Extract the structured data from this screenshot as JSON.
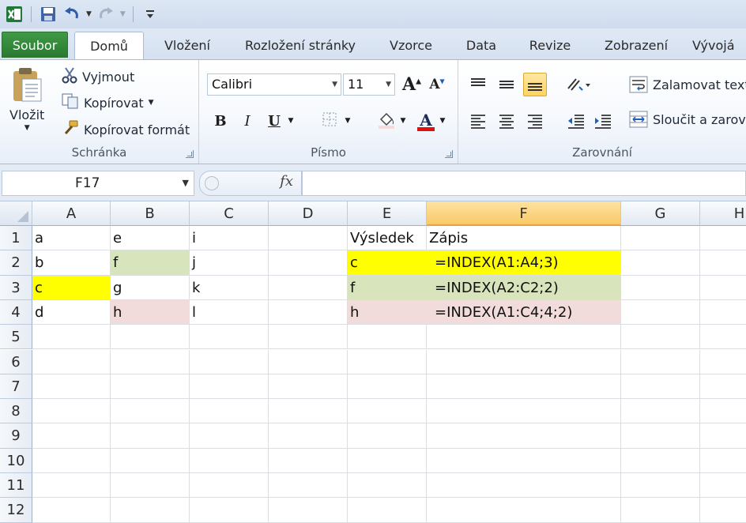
{
  "colors": {
    "yellow": "#ffff00",
    "green": "#d8e4bc",
    "pink": "#f2dcdb",
    "file_tab": "#2e7d32",
    "accent_blue": "#1f5fb4"
  },
  "qat": {
    "icons": [
      "excel-logo-icon",
      "save-icon",
      "undo-icon",
      "redo-icon",
      "customize-icon"
    ]
  },
  "tabs": [
    {
      "label": "Soubor",
      "active": false
    },
    {
      "label": "Domů",
      "active": true
    },
    {
      "label": "Vložení",
      "active": false
    },
    {
      "label": "Rozložení stránky",
      "active": false
    },
    {
      "label": "Vzorce",
      "active": false
    },
    {
      "label": "Data",
      "active": false
    },
    {
      "label": "Revize",
      "active": false
    },
    {
      "label": "Zobrazení",
      "active": false
    },
    {
      "label": "Vývojá",
      "active": false
    }
  ],
  "clipboard": {
    "paste": "Vložit",
    "cut": "Vyjmout",
    "copy": "Kopírovat",
    "format_painter": "Kopírovat formát",
    "label": "Schránka"
  },
  "font": {
    "name": "Calibri",
    "size": "11",
    "bold": "B",
    "italic": "I",
    "underline": "U",
    "label": "Písmo"
  },
  "alignment": {
    "wrap": "Zalamovat text",
    "merge": "Sloučit a zarov",
    "label": "Zarovnání"
  },
  "formula_bar": {
    "name_box": "F17",
    "fx": "fx",
    "formula": ""
  },
  "grid": {
    "columns": [
      "A",
      "B",
      "C",
      "D",
      "E",
      "F",
      "G",
      "H"
    ],
    "active_column": "F",
    "rows": [
      "1",
      "2",
      "3",
      "4",
      "5",
      "6",
      "7",
      "8",
      "9",
      "10",
      "11",
      "12"
    ],
    "cells": {
      "A1": "a",
      "B1": "e",
      "C1": "i",
      "E1": "Výsledek",
      "F1": "Zápis",
      "A2": "b",
      "B2": "f",
      "C2": "j",
      "E2": "c",
      "F2": "=INDEX(A1:A4;3)",
      "A3": "c",
      "B3": "g",
      "C3": "k",
      "E3": "f",
      "F3": "=INDEX(A2:C2;2)",
      "A4": "d",
      "B4": "h",
      "C4": "l",
      "E4": "h",
      "F4": "=INDEX(A1:C4;4;2)"
    },
    "fills": {
      "B2": "green",
      "A3": "yellow",
      "B4": "pink",
      "E2": "yellow",
      "F2": "yellow",
      "E3": "green",
      "F3": "green",
      "E4": "pink",
      "F4": "pink"
    }
  }
}
